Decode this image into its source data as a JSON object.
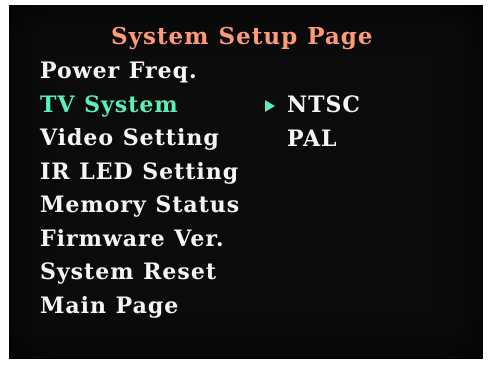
{
  "colors": {
    "title": "#ff9a78",
    "item": "#f5f5f5",
    "selected": "#5af0b8",
    "background": "#0b0b0b"
  },
  "title": "System Setup Page",
  "menu": {
    "items": [
      {
        "label": "Power Freq.",
        "selected": false
      },
      {
        "label": "TV System",
        "selected": true
      },
      {
        "label": "Video Setting",
        "selected": false
      },
      {
        "label": "IR LED Setting",
        "selected": false
      },
      {
        "label": "Memory Status",
        "selected": false
      },
      {
        "label": "Firmware Ver.",
        "selected": false
      },
      {
        "label": "System Reset",
        "selected": false
      },
      {
        "label": "Main Page",
        "selected": false
      }
    ]
  },
  "options": {
    "items": [
      {
        "label": "NTSC",
        "selected": true,
        "icon": "selection-arrow-icon"
      },
      {
        "label": "PAL",
        "selected": false
      }
    ]
  }
}
